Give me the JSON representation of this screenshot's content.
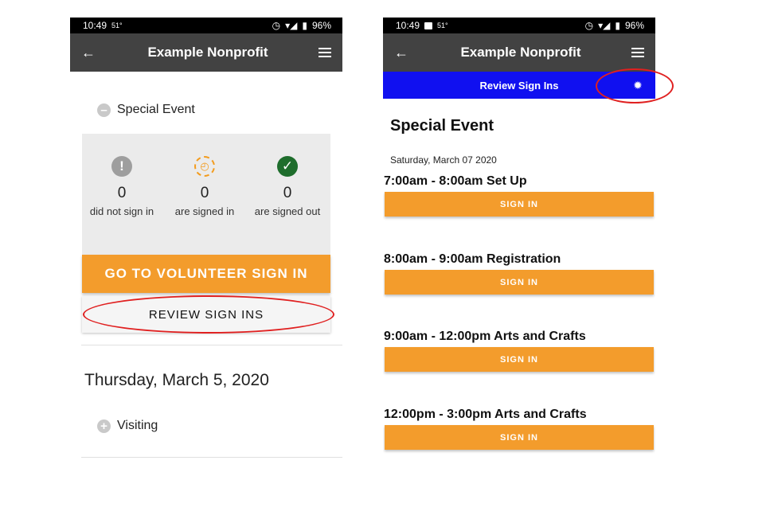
{
  "status_bar": {
    "time": "10:49",
    "temp": "51°",
    "battery": "96%"
  },
  "app_bar": {
    "title": "Example Nonprofit"
  },
  "left_screen": {
    "special_event_label": "Special Event",
    "stats": [
      {
        "icon": "alert-icon",
        "count": "0",
        "label": "did not sign in"
      },
      {
        "icon": "clock-icon",
        "count": "0",
        "label": "are signed in"
      },
      {
        "icon": "check-icon",
        "count": "0",
        "label": "are signed out"
      }
    ],
    "go_button": "GO TO VOLUNTEER SIGN IN",
    "review_button": "REVIEW SIGN INS",
    "date_heading": "Thursday, March 5, 2020",
    "visiting_label": "Visiting"
  },
  "right_screen": {
    "review_bar_title": "Review Sign Ins",
    "event_title": "Special Event",
    "event_date": "Saturday, March 07 2020",
    "slots": [
      {
        "title": "7:00am - 8:00am Set Up",
        "button": "SIGN IN"
      },
      {
        "title": "8:00am - 9:00am Registration",
        "button": "SIGN IN"
      },
      {
        "title": "9:00am - 12:00pm Arts and Crafts",
        "button": "SIGN IN"
      },
      {
        "title": "12:00pm - 3:00pm Arts and Crafts",
        "button": "SIGN IN"
      }
    ]
  },
  "colors": {
    "accent_orange": "#f39c2c",
    "app_bar": "#424242",
    "review_bar": "#1010f0",
    "annotation": "#e02020",
    "check_green": "#1e6d2c"
  }
}
